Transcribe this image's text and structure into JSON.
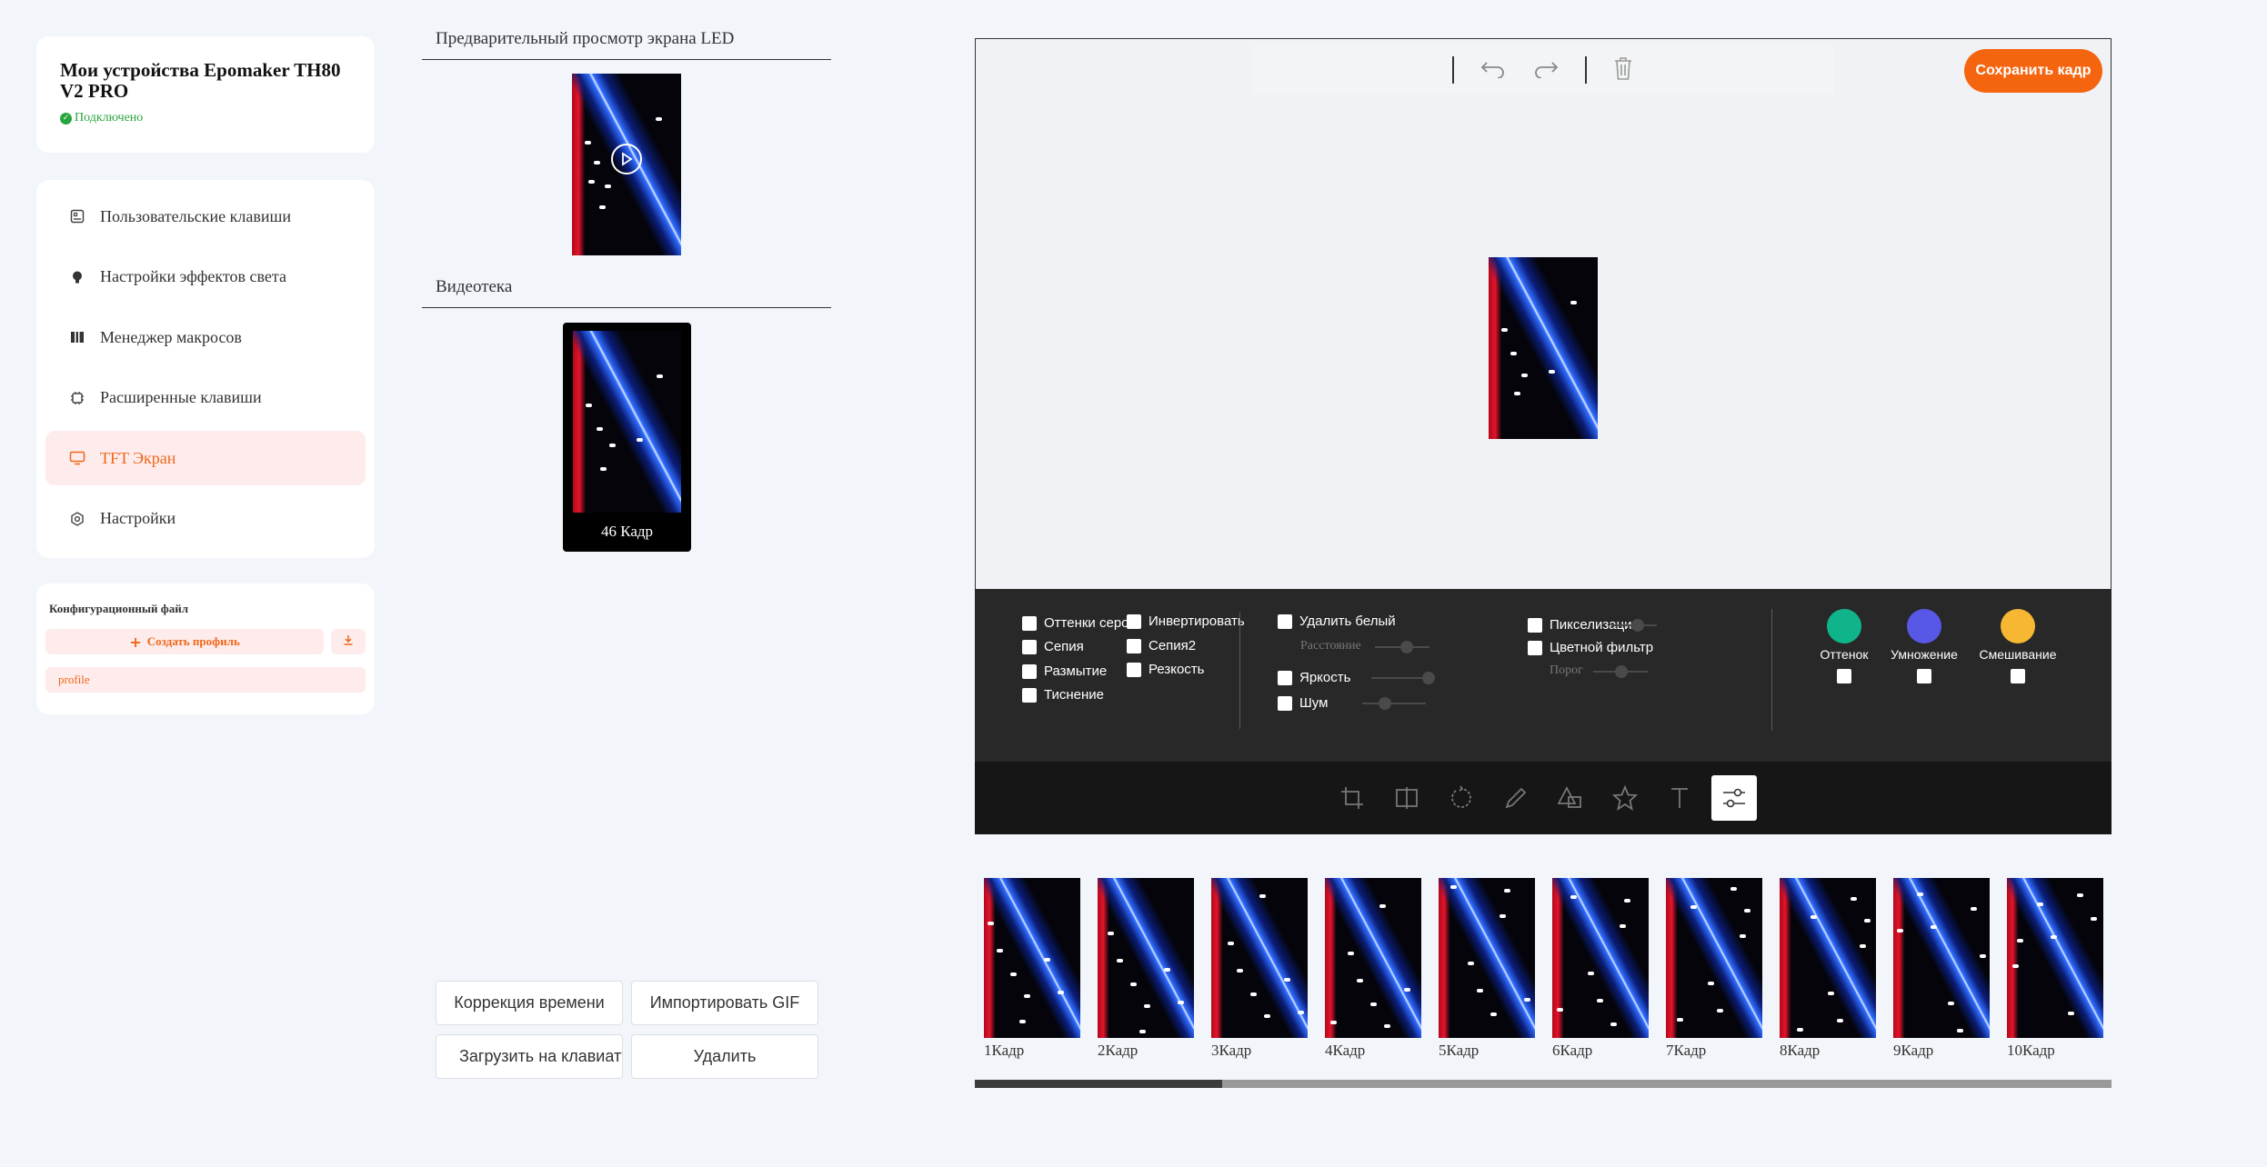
{
  "device": {
    "name": "Мои устройства Epomaker TH80 V2 PRO",
    "status": "Подключено"
  },
  "nav": {
    "items": [
      {
        "label": "Пользовательские клавиши",
        "icon": "custom-keys-icon"
      },
      {
        "label": "Настройки эффектов света",
        "icon": "light-bulb-icon"
      },
      {
        "label": "Менеджер макросов",
        "icon": "macro-icon"
      },
      {
        "label": "Расширенные клавиши",
        "icon": "chip-icon"
      },
      {
        "label": "TFT Экран",
        "icon": "monitor-icon",
        "active": true
      },
      {
        "label": "Настройки",
        "icon": "gear-icon"
      }
    ]
  },
  "config": {
    "title": "Конфигурационный файл",
    "create_profile": "Создать профиль",
    "profile_name": "profile"
  },
  "preview": {
    "title": "Предварительный просмотр экрана LED"
  },
  "library": {
    "title": "Видеотека",
    "item_label": "46 Кадр"
  },
  "actions": {
    "time_correction": "Коррекция времени",
    "import_gif": "Импортировать GIF",
    "upload_to_keyboard": "Загрузить на клавиатуру",
    "delete": "Удалить"
  },
  "editor": {
    "save_frame": "Сохранить кадр",
    "filters": {
      "grayscale": "Оттенки серого",
      "invert": "Инвертировать",
      "sepia": "Сепия",
      "sepia2": "Сепия2",
      "blur": "Размытие",
      "sharpen": "Резкость",
      "emboss": "Тиснение",
      "remove_white": "Удалить белый",
      "distance": "Расстояние",
      "brightness": "Яркость",
      "noise": "Шум",
      "pixelate": "Пикселизация",
      "color_filter": "Цветной фильтр",
      "threshold": "Порог"
    },
    "color_modes": [
      {
        "label": "Оттенок",
        "color": "#10b48a"
      },
      {
        "label": "Умножение",
        "color": "#5858e6"
      },
      {
        "label": "Смешивание",
        "color": "#f7b733"
      }
    ]
  },
  "frames": [
    "1Кадр",
    "2Кадр",
    "3Кадр",
    "4Кадр",
    "5Кадр",
    "6Кадр",
    "7Кадр",
    "8Кадр",
    "9Кадр",
    "10Кадр"
  ],
  "colors": {
    "accent": "#f5650f",
    "active_bg": "#fdeceb",
    "connected": "#27a53c"
  }
}
